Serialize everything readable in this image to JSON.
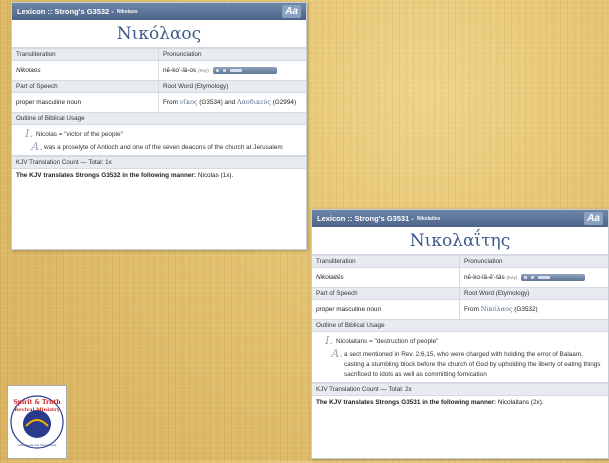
{
  "panels": [
    {
      "header_title": "Lexicon :: Strong's G3532 -",
      "header_small": "Nikolaos",
      "aa_label": "Aa",
      "word": "Νικόλαος",
      "labels": {
        "transliteration": "Transliteration",
        "pronunciation": "Pronunciation",
        "part_of_speech": "Part of Speech",
        "root_word": "Root Word (Etymology)",
        "outline": "Outline of Biblical Usage",
        "translation_count": "KJV Translation Count — Total: 1x"
      },
      "transliteration": "Nikolaos",
      "pronunciation": "nē-ko'-lä-os",
      "pronunciation_key": "(Key)",
      "part_of_speech": "proper masculine noun",
      "root_prefix": "From",
      "root_link1": "νῖκος",
      "root_ref1": "(G3534) and",
      "root_link2": "Λαοδικεύς",
      "root_ref2": "(G2994)",
      "outline": [
        {
          "marker": "I.",
          "text": "Nicolas = \"victor of the people\""
        },
        {
          "marker": "A.",
          "text": "was a proselyte of Antioch and one of the seven deacons of the church at Jerusalem"
        }
      ],
      "kjv_bold": "The KJV translates Strongs G3532 in the following manner:",
      "kjv_rest": "Nicolas (1x)."
    },
    {
      "header_title": "Lexicon :: Strong's G3531 -",
      "header_small": "Nikolaites",
      "aa_label": "Aa",
      "word": "Νικολαΐτης",
      "labels": {
        "transliteration": "Transliteration",
        "pronunciation": "Pronunciation",
        "part_of_speech": "Part of Speech",
        "root_word": "Root Word (Etymology)",
        "outline": "Outline of Biblical Usage",
        "translation_count": "KJV Translation Count — Total: 2x"
      },
      "transliteration": "Nikolaitēs",
      "pronunciation": "nē-ko-lä-ē'-tās",
      "pronunciation_key": "(Key)",
      "part_of_speech": "proper masculine noun",
      "root_prefix": "From",
      "root_link1": "Νικόλαος",
      "root_ref1": "(G3532)",
      "outline": [
        {
          "marker": "I.",
          "text": "Nicolaitans = \"destruction of people\""
        },
        {
          "marker": "A.",
          "text": "a sect mentioned in Rev. 2:6,15, who were charged with holding the error of Balaam, casting a stumbling block before the church of God by upholding the liberty of eating things sacrificed to idols as well as committing fornication"
        }
      ],
      "kjv_bold": "The KJV translates Strongs G3531 in the following manner:",
      "kjv_rest": "Nicolaitans (2x)."
    }
  ],
  "logo": {
    "line1": "Spirit & Truth",
    "line2": "Revival Ministry",
    "line3": "Until we are one forevermore",
    "colors": {
      "red": "#c62828",
      "gold": "#f2b400",
      "blue": "#2a3a8c"
    }
  }
}
